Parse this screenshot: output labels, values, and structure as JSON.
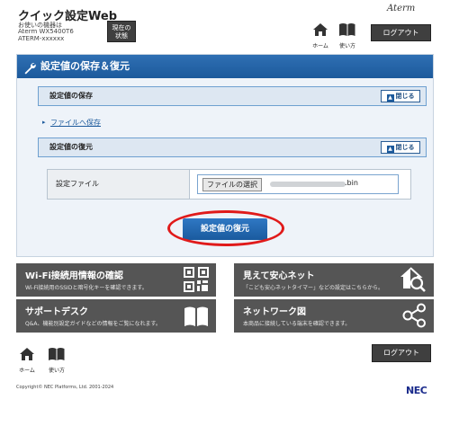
{
  "header": {
    "app_title": "クイック設定Web",
    "device_label": "お使いの機器は",
    "device_model": "Aterm WX5400T6",
    "device_id": "ATERM-xxxxxx",
    "status_button": "現在の\n状態",
    "brand": "Aterm",
    "home_label": "ホーム",
    "guide_label": "使い方",
    "logout_label": "ログアウト"
  },
  "panel": {
    "title": "設定値の保存＆復元",
    "save_section": {
      "title": "設定値の保存",
      "close_label": "閉じる",
      "link_text": "ファイルへ保存"
    },
    "restore_section": {
      "title": "設定値の復元",
      "close_label": "閉じる",
      "field_label": "設定ファイル",
      "choose_button": "ファイルの選択",
      "file_name_suffix": ".bin",
      "restore_button": "設定値の復元"
    }
  },
  "tiles": [
    {
      "title": "Wi-Fi接続用情報の確認",
      "desc": "Wi-Fi接続用のSSIDと暗号化キーを確認できます。",
      "icon": "qr-code-icon"
    },
    {
      "title": "見えて安心ネット",
      "desc": "「こども安心ネットタイマー」などの設定はこちらから。",
      "icon": "house-magnifier-icon"
    },
    {
      "title": "サポートデスク",
      "desc": "Q&A、機能別設定ガイドなどの情報をご覧になれます。",
      "icon": "book-icon"
    },
    {
      "title": "ネットワーク図",
      "desc": "本商品に接続している端末を確認できます。",
      "icon": "network-icon"
    }
  ],
  "footer": {
    "home_label": "ホーム",
    "guide_label": "使い方",
    "logout_label": "ログアウト",
    "copyright": "Copyright© NEC Platforms, Ltd. 2001-2024",
    "logo": "NEC"
  },
  "colors": {
    "accent": "#1c5a9c",
    "highlight": "#e01a1a",
    "tile": "#555555"
  }
}
